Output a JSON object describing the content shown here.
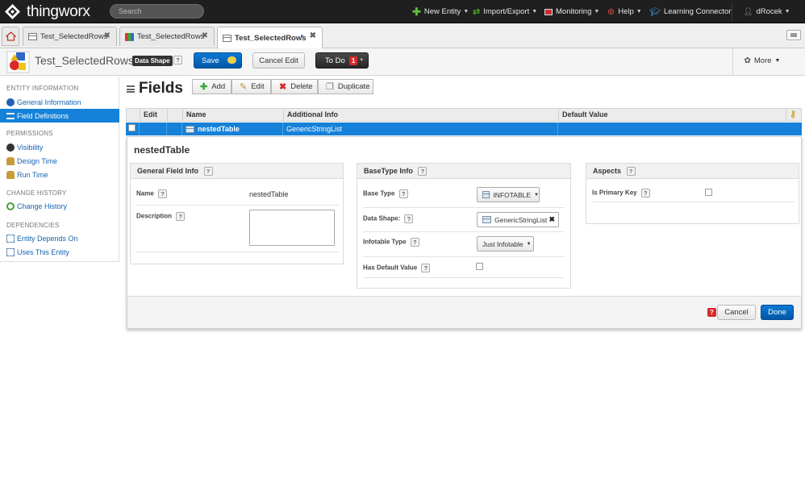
{
  "topbar": {
    "brand": "thingworx",
    "search_placeholder": "Search",
    "nav": [
      {
        "label": "New Entity",
        "icon": "plus-icon"
      },
      {
        "label": "Import/Export",
        "icon": "swap-arrows-icon"
      },
      {
        "label": "Monitoring",
        "icon": "monitor-icon"
      },
      {
        "label": "Help",
        "icon": "lifebuoy-icon"
      },
      {
        "label": "Learning Connector",
        "icon": "graduation-cap-icon"
      },
      {
        "label": "dRocek",
        "icon": "user-icon"
      }
    ]
  },
  "tabs": [
    {
      "label": "Test_SelectedRows",
      "active": false
    },
    {
      "label": "Test_SelectedRows",
      "active": false
    },
    {
      "label": "Test_SelectedRows",
      "active": true
    }
  ],
  "entity": {
    "name": "Test_SelectedRows",
    "type_badge": "Data Shape",
    "help": "?",
    "save_label": "Save",
    "cancel_edit_label": "Cancel Edit",
    "todo_label": "To Do",
    "todo_count": "1",
    "more_label": "More"
  },
  "sidebar": {
    "sections": [
      {
        "heading": "ENTITY INFORMATION",
        "items": [
          "General Information",
          "Field Definitions"
        ]
      },
      {
        "heading": "PERMISSIONS",
        "items": [
          "Visibility",
          "Design Time",
          "Run Time"
        ]
      },
      {
        "heading": "CHANGE HISTORY",
        "items": [
          "Change History"
        ]
      },
      {
        "heading": "DEPENDENCIES",
        "items": [
          "Entity Depends On",
          "Uses This Entity"
        ]
      }
    ],
    "active_item": "Field Definitions"
  },
  "fields": {
    "title": "Fields",
    "toolbar": {
      "add": "Add",
      "edit": "Edit",
      "delete": "Delete",
      "duplicate": "Duplicate"
    },
    "columns": [
      "Edit",
      "Name",
      "Additional Info",
      "Default Value"
    ],
    "rows": [
      {
        "name": "nestedTable",
        "additional_info": "GenericStringList",
        "default_value": ""
      }
    ]
  },
  "editor": {
    "title": "nestedTable",
    "general": {
      "heading": "General Field Info",
      "name_label": "Name",
      "name_value": "nestedTable",
      "description_label": "Description",
      "description_value": ""
    },
    "basetype": {
      "heading": "BaseType Info",
      "base_type_label": "Base Type",
      "base_type_value": "INFOTABLE",
      "data_shape_label": "Data Shape:",
      "data_shape_value": "GenericStringList",
      "infotable_type_label": "Infotable Type",
      "infotable_type_value": "Just Infotable",
      "has_default_label": "Has Default Value",
      "has_default_checked": false
    },
    "aspects": {
      "heading": "Aspects",
      "primary_key_label": "Is Primary Key",
      "primary_key_checked": false
    },
    "cancel_label": "Cancel",
    "done_label": "Done"
  }
}
